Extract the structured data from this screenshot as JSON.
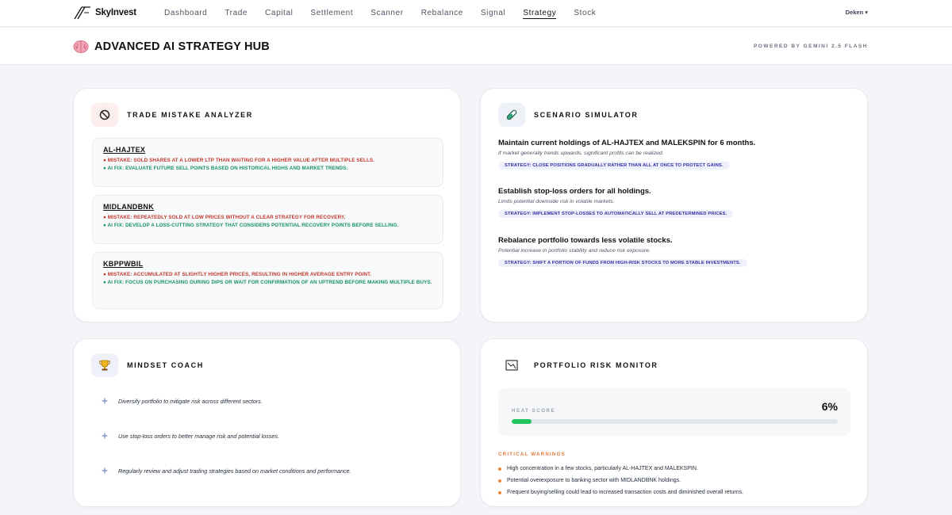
{
  "nav": {
    "brand": "SkyInvest",
    "items": [
      "Dashboard",
      "Trade",
      "Capital",
      "Settlement",
      "Scanner",
      "Rebalance",
      "Signal",
      "Strategy",
      "Stock"
    ],
    "active": "Strategy",
    "user": "Deken ▾"
  },
  "header": {
    "title": "ADVANCED AI STRATEGY HUB",
    "powered_by": "POWERED BY GEMINI 2.5 FLASH"
  },
  "mistake_analyzer": {
    "title": "TRADE MISTAKE ANALYZER",
    "items": [
      {
        "ticker": "AL-HAJTEX",
        "mistake": "● MISTAKE: SOLD SHARES AT A LOWER LTP THAN WAITING FOR A HIGHER VALUE AFTER MULTIPLE SELLS.",
        "fix": "● AI FIX: EVALUATE FUTURE SELL POINTS BASED ON HISTORICAL HIGHS AND MARKET TRENDS."
      },
      {
        "ticker": "MIDLANDBNK",
        "mistake": "● MISTAKE: REPEATEDLY SOLD AT LOW PRICES WITHOUT A CLEAR STRATEGY FOR RECOVERY.",
        "fix": "● AI FIX: DEVELOP A LOSS-CUTTING STRATEGY THAT CONSIDERS POTENTIAL RECOVERY POINTS BEFORE SELLING."
      },
      {
        "ticker": "KBPPWBIL",
        "mistake": "● MISTAKE: ACCUMULATED AT SLIGHTLY HIGHER PRICES, RESULTING IN HIGHER AVERAGE ENTRY POINT.",
        "fix": "● AI FIX: FOCUS ON PURCHASING DURING DIPS OR WAIT FOR CONFIRMATION OF AN UPTREND BEFORE MAKING MULTIPLE BUYS."
      }
    ]
  },
  "scenario_simulator": {
    "title": "SCENARIO SIMULATOR",
    "items": [
      {
        "title": "Maintain current holdings of AL-HAJTEX and MALEKSPIN for 6 months.",
        "subtitle": "If market generally trends upwards, significant profits can be realized.",
        "strategy": "STRATEGY: CLOSE POSITIONS GRADUALLY RATHER THAN ALL AT ONCE TO PROTECT GAINS."
      },
      {
        "title": "Establish stop-loss orders for all holdings.",
        "subtitle": "Limits potential downside risk in volatile markets.",
        "strategy": "STRATEGY: IMPLEMENT STOP-LOSSES TO AUTOMATICALLY SELL AT PREDETERMINED PRICES."
      },
      {
        "title": "Rebalance portfolio towards less volatile stocks.",
        "subtitle": "Potential increase in portfolio stability and reduce risk exposure.",
        "strategy": "STRATEGY: SHIFT A PORTION OF FUNDS FROM HIGH-RISK STOCKS TO MORE STABLE INVESTMENTS."
      }
    ]
  },
  "mindset_coach": {
    "title": "MINDSET COACH",
    "tips": [
      "Diversify portfolio to mitigate risk across different sectors.",
      "Use stop-loss orders to better manage risk and potential losses.",
      "Regularly review and adjust trading strategies based on market conditions and performance."
    ]
  },
  "risk_monitor": {
    "title": "PORTFOLIO RISK MONITOR",
    "heat_label": "HEAT SCORE",
    "heat_value": "6%",
    "heat_fraction": 0.06,
    "warnings_title": "CRITICAL WARNINGS",
    "warnings": [
      "High concentration in a few stocks, particularly AL-HAJTEX and MALEKSPIN.",
      "Potential overexposure to banking sector with MIDLANDBNK holdings.",
      "Frequent buying/selling could lead to increased transaction costs and diminished overall returns."
    ]
  },
  "colors": {
    "mistake_red": "#c0392b",
    "fix_green": "#17935f",
    "strategy_indigo": "#3730a3",
    "warning_orange": "#f08a3c",
    "heat_green": "#22c55e"
  },
  "icons": {
    "mistake_analyzer": "no-entry-icon",
    "scenario_simulator": "test-tube-icon",
    "mindset_coach": "trophy-icon",
    "risk_monitor": "chart-frame-icon",
    "header": "brain-icon",
    "tips": "sparkle-icon"
  }
}
